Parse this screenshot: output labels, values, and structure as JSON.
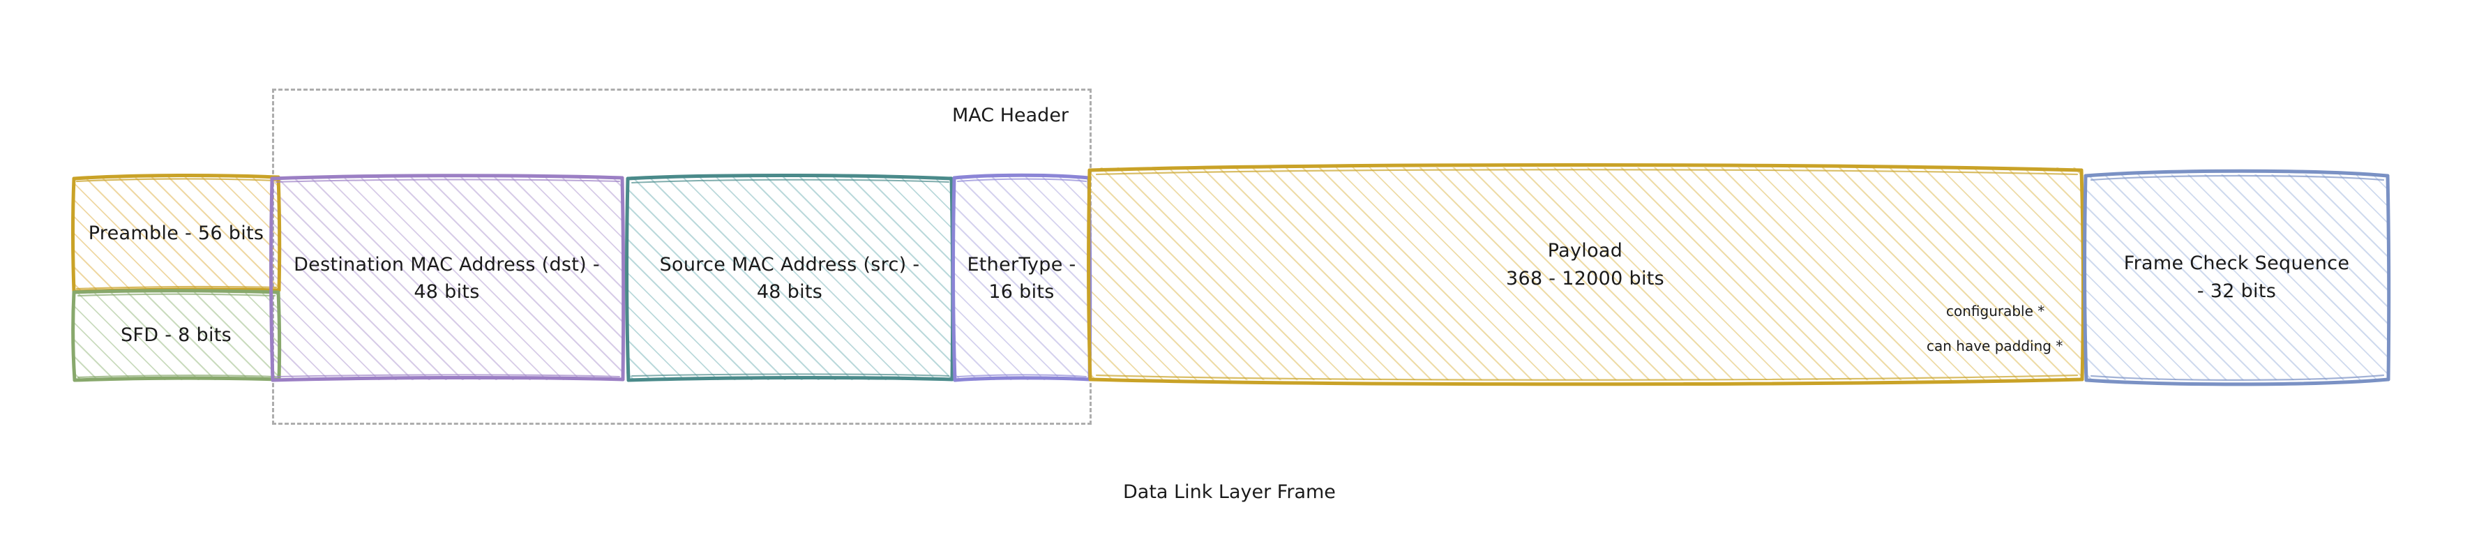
{
  "diagram": {
    "caption": "Data Link Layer Frame",
    "background_color": "#ffffff",
    "text_color": "#1a1a1a"
  },
  "mac_header_group": {
    "label": "MAC Header",
    "border_style": "dashed",
    "border_color": "#adadad"
  },
  "fields": [
    {
      "id": "preamble",
      "label": "Preamble - 56 bits",
      "bits": 56,
      "stroke_color": "#c9a227",
      "hatch_color": "#e2b858"
    },
    {
      "id": "sfd",
      "label": "SFD - 8 bits",
      "bits": 8,
      "stroke_color": "#88a86c",
      "hatch_color": "#8ab070"
    },
    {
      "id": "destination-mac",
      "label": "Destination MAC Address (dst) -\n48 bits",
      "bits": 48,
      "stroke_color": "#9b7fc4",
      "hatch_color": "#9b7fc4"
    },
    {
      "id": "source-mac",
      "label": "Source MAC Address (src) -\n48 bits",
      "bits": 48,
      "stroke_color": "#4a8a8a",
      "hatch_color": "#5ca4aa"
    },
    {
      "id": "ethertype",
      "label": "EtherType -\n16 bits",
      "bits": 16,
      "stroke_color": "#8b85d6",
      "hatch_color": "#968fd6"
    },
    {
      "id": "payload",
      "label": "Payload\n368 - 12000 bits",
      "bits_min": 368,
      "bits_max": 12000,
      "stroke_color": "#c9a227",
      "hatch_color": "#e8d08a"
    },
    {
      "id": "frame-check-sequence",
      "label": "Frame Check Sequence\n- 32 bits",
      "bits": 32,
      "stroke_color": "#7a91c4",
      "hatch_color": "#8ca6d6"
    }
  ],
  "payload_notes": [
    {
      "id": "configurable",
      "text": "configurable *"
    },
    {
      "id": "padding",
      "text": "can have padding *"
    }
  ]
}
